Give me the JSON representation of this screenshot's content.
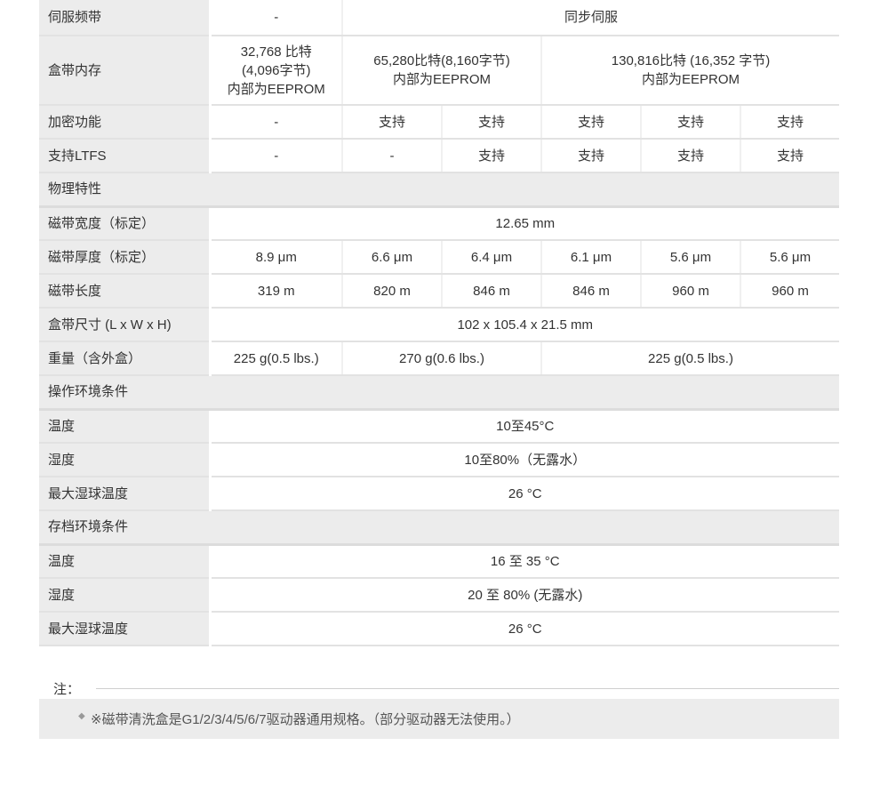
{
  "rows": {
    "servo_band": {
      "label": "伺服频带",
      "c1": "-",
      "c2": "同步伺服"
    },
    "cart_memory": {
      "label": "盒带内存",
      "c1": [
        "32,768 比特",
        "(4,096字节)",
        "内部为EEPROM"
      ],
      "c2": [
        "65,280比特(8,160字节)",
        "内部为EEPROM"
      ],
      "c3": [
        "130,816比特 (16,352 字节)",
        "内部为EEPROM"
      ]
    },
    "encryption": {
      "label": "加密功能",
      "values": [
        "-",
        "支持",
        "支持",
        "支持",
        "支持",
        "支持"
      ]
    },
    "ltfs": {
      "label": "支持LTFS",
      "values": [
        "-",
        "-",
        "支持",
        "支持",
        "支持",
        "支持"
      ]
    },
    "physical_section": {
      "label": "物理特性"
    },
    "tape_width": {
      "label": "磁带宽度（标定）",
      "value": "12.65 mm"
    },
    "tape_thickness": {
      "label": "磁带厚度（标定）",
      "values": [
        "8.9 μm",
        "6.6 μm",
        "6.4 μm",
        "6.1 μm",
        "5.6 μm",
        "5.6 μm"
      ]
    },
    "tape_length": {
      "label": "磁带长度",
      "values": [
        "319 m",
        "820 m",
        "846 m",
        "846 m",
        "960 m",
        "960 m"
      ]
    },
    "cart_size": {
      "label": "盒带尺寸 (L x W x H)",
      "value": "102 x 105.4 x 21.5 mm"
    },
    "weight": {
      "label": "重量（含外盒）",
      "c1": "225 g(0.5 lbs.)",
      "c2": "270 g(0.6 lbs.)",
      "c3": "225 g(0.5 lbs.)"
    },
    "operating_section": {
      "label": "操作环境条件"
    },
    "op_temp": {
      "label": "温度",
      "value": "10至45°C"
    },
    "op_humidity": {
      "label": "湿度",
      "value": "10至80%（无露水）"
    },
    "op_wetbulb": {
      "label": "最大湿球温度",
      "value": "26 °C"
    },
    "archive_section": {
      "label": "存档环境条件"
    },
    "ar_temp": {
      "label": "温度",
      "value": "16 至 35 °C"
    },
    "ar_humidity": {
      "label": "湿度",
      "value": "20 至 80% (无露水)"
    },
    "ar_wetbulb": {
      "label": "最大湿球温度",
      "value": "26 °C"
    }
  },
  "note": {
    "title": "注：",
    "text": "※磁带清洗盒是G1/2/3/4/5/6/7驱动器通用规格。（部分驱动器无法使用。）"
  }
}
